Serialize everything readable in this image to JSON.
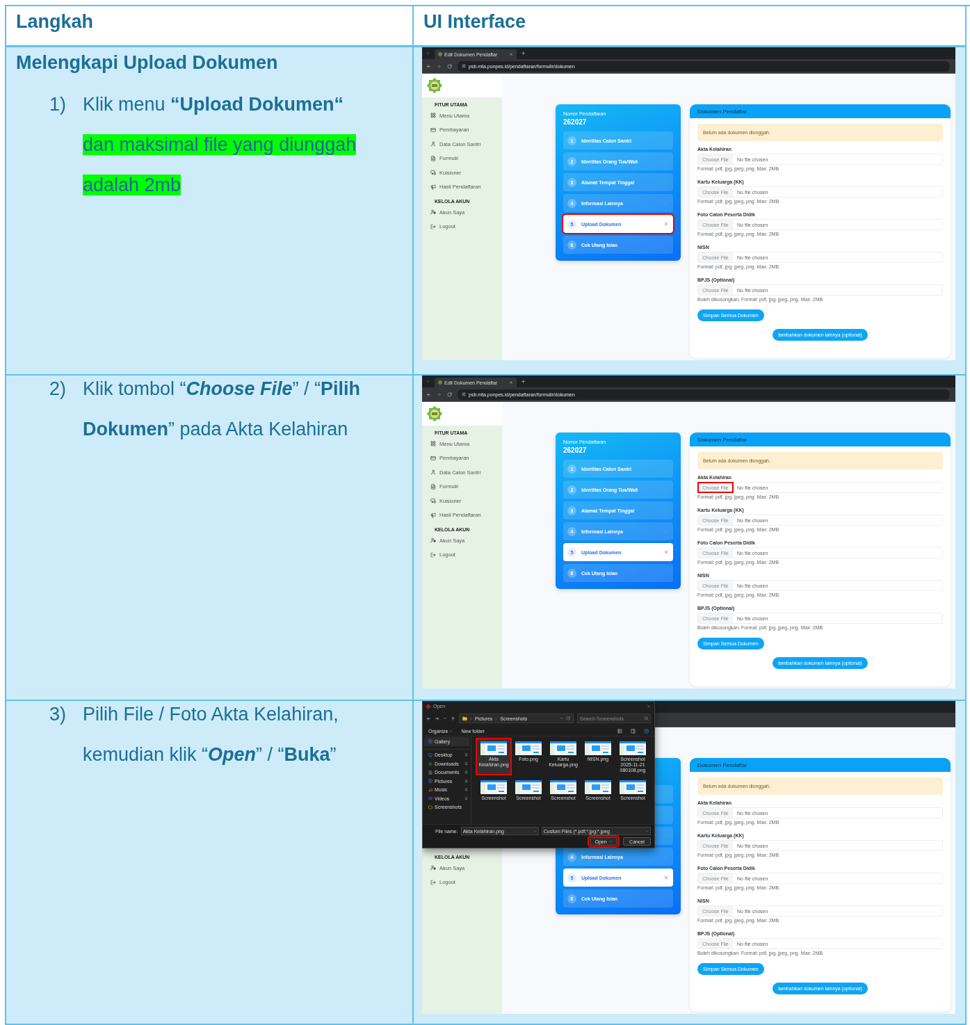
{
  "table": {
    "columns": [
      "Langkah",
      "UI Interface"
    ]
  },
  "rows": [
    {
      "heading": "Melengkapi Upload Dokumen",
      "step": {
        "number": "1)",
        "text": "Klik menu **“Upload Dokumen“**",
        "highlight": "dan maksimal file yang diunggah adalah 2mb"
      },
      "screen": {
        "browser": {
          "tab_title": "Edit Dokumen Pendaftar",
          "url": "psb.mta.ponpes.id/pendaftaran/formulir/dokumen"
        },
        "sidebar": [
          {
            "kind": "heading",
            "label": "FITUR UTAMA"
          },
          {
            "kind": "link",
            "label": "Menu Utama"
          },
          {
            "kind": "link",
            "label": "Pembayaran"
          },
          {
            "kind": "link",
            "label": "Data Calon Santri"
          },
          {
            "kind": "link",
            "label": "Formulir"
          },
          {
            "kind": "link",
            "label": "Kuisioner"
          },
          {
            "kind": "link",
            "label": "Hasil Pendaftaran"
          },
          {
            "kind": "heading",
            "label": "KELOLA AKUN"
          },
          {
            "kind": "link",
            "label": "Akun Saya"
          },
          {
            "kind": "link",
            "label": "Logout"
          }
        ],
        "registration": {
          "label": "Nomor Pendaftaran",
          "number": "262027"
        },
        "steps": [
          {
            "number": "1",
            "label": "Identitas Calon Santri",
            "checked": true,
            "error": false,
            "selected": false,
            "highlighted": false
          },
          {
            "number": "2",
            "label": "Identitas Orang Tua/Wali",
            "checked": true,
            "error": false,
            "selected": false,
            "highlighted": false
          },
          {
            "number": "3",
            "label": "Alamat Tempat Tinggal",
            "checked": true,
            "error": false,
            "selected": false,
            "highlighted": false
          },
          {
            "number": "4",
            "label": "Informasi Lainnya",
            "checked": true,
            "error": false,
            "selected": false,
            "highlighted": false
          },
          {
            "number": "5",
            "label": "Upload Dokumen",
            "checked": false,
            "error": true,
            "selected": true,
            "highlighted": true
          },
          {
            "number": "6",
            "label": "Cek Ulang Isian",
            "checked": false,
            "error": false,
            "selected": false,
            "highlighted": false
          }
        ],
        "documents": {
          "title": "Dokumen Pendaftar",
          "alert": "Belum ada dokumen diunggah.",
          "fields": [
            {
              "label": "Akta Kelahiran",
              "button": "Choose File",
              "value": "No file chosen",
              "hint": "Format: pdf, jpg, jpeg, png. Max: 2MB",
              "highlighted": false
            },
            {
              "label": "Kartu Keluarga (KK)",
              "button": "Choose File",
              "value": "No file chosen",
              "hint": "Format: pdf, jpg, jpeg, png. Max: 2MB",
              "highlighted": false
            },
            {
              "label": "Foto Calon Peserta Didik",
              "button": "Choose File",
              "value": "No file chosen",
              "hint": "Format: pdf, jpg, jpeg, png. Max: 2MB",
              "highlighted": false
            },
            {
              "label": "NISN",
              "button": "Choose File",
              "value": "No file chosen",
              "hint": "Format: pdf, jpg, jpeg, png. Max: 2MB",
              "highlighted": false
            },
            {
              "label": "BPJS (Optional)",
              "button": "Choose File",
              "value": "No file chosen",
              "hint": "Boleh dikosongkan. Format: pdf, jpg, jpeg, png. Max: 2MB",
              "highlighted": false
            }
          ],
          "save": "Simpan Semua Dokumen",
          "add": "tambahkan dokumen lainnya (optional)"
        }
      }
    },
    {
      "step": {
        "number": "2)",
        "text": "Klik tombol “*Choose File*” / “**Pilih Dokumen**” pada Akta Kelahiran"
      },
      "screen": {
        "browser": {
          "tab_title": "Edit Dokumen Pendaftar",
          "url": "psb.mta.ponpes.id/pendaftaran/formulir/dokumen"
        },
        "sidebar": [
          {
            "kind": "heading",
            "label": "FITUR UTAMA"
          },
          {
            "kind": "link",
            "label": "Menu Utama"
          },
          {
            "kind": "link",
            "label": "Pembayaran"
          },
          {
            "kind": "link",
            "label": "Data Calon Santri"
          },
          {
            "kind": "link",
            "label": "Formulir"
          },
          {
            "kind": "link",
            "label": "Kuisioner"
          },
          {
            "kind": "link",
            "label": "Hasil Pendaftaran"
          },
          {
            "kind": "heading",
            "label": "KELOLA AKUN"
          },
          {
            "kind": "link",
            "label": "Akun Saya"
          },
          {
            "kind": "link",
            "label": "Logout"
          }
        ],
        "registration": {
          "label": "Nomor Pendaftaran",
          "number": "262027"
        },
        "steps": [
          {
            "number": "1",
            "label": "Identitas Calon Santri",
            "checked": true,
            "error": false,
            "selected": false,
            "highlighted": false
          },
          {
            "number": "2",
            "label": "Identitas Orang Tua/Wali",
            "checked": true,
            "error": false,
            "selected": false,
            "highlighted": false
          },
          {
            "number": "3",
            "label": "Alamat Tempat Tinggal",
            "checked": true,
            "error": false,
            "selected": false,
            "highlighted": false
          },
          {
            "number": "4",
            "label": "Informasi Lainnya",
            "checked": true,
            "error": false,
            "selected": false,
            "highlighted": false
          },
          {
            "number": "5",
            "label": "Upload Dokumen",
            "checked": false,
            "error": true,
            "selected": true,
            "highlighted": false
          },
          {
            "number": "6",
            "label": "Cek Ulang Isian",
            "checked": false,
            "error": false,
            "selected": false,
            "highlighted": false
          }
        ],
        "documents": {
          "title": "Dokumen Pendaftar",
          "alert": "Belum ada dokumen diunggah.",
          "fields": [
            {
              "label": "Akta Kelahiran",
              "button": "Choose File",
              "value": "No file chosen",
              "hint": "Format: pdf, jpg, jpeg, png. Max: 2MB",
              "highlighted": true
            },
            {
              "label": "Kartu Keluarga (KK)",
              "button": "Choose File",
              "value": "No file chosen",
              "hint": "Format: pdf, jpg, jpeg, png. Max: 2MB",
              "highlighted": false
            },
            {
              "label": "Foto Calon Peserta Didik",
              "button": "Choose File",
              "value": "No file chosen",
              "hint": "Format: pdf, jpg, jpeg, png. Max: 2MB",
              "highlighted": false
            },
            {
              "label": "NISN",
              "button": "Choose File",
              "value": "No file chosen",
              "hint": "Format: pdf, jpg, jpeg, png. Max: 2MB",
              "highlighted": false
            },
            {
              "label": "BPJS (Optional)",
              "button": "Choose File",
              "value": "No file chosen",
              "hint": "Boleh dikosongkan. Format: pdf, jpg, jpeg, png. Max: 2MB",
              "highlighted": false
            }
          ],
          "save": "Simpan Semua Dokumen",
          "add": "tambahkan dokumen lainnya (optional)"
        }
      }
    },
    {
      "step": {
        "number": "3)",
        "text": "Pilih File / Foto Akta Kelahiran, kemudian klik “*Open*” / “**Buka**”"
      },
      "screen": {
        "sidebar": [
          {
            "kind": "heading",
            "label": "KELOLA AKUN"
          },
          {
            "kind": "link",
            "label": "Akun Saya"
          },
          {
            "kind": "link",
            "label": "Logout"
          }
        ],
        "steps": [
          {
            "checked": true,
            "error": false,
            "selected": false,
            "highlighted": false
          },
          {
            "checked": true,
            "error": false,
            "selected": false,
            "highlighted": false
          },
          {
            "checked": true,
            "error": false,
            "selected": false,
            "highlighted": false
          },
          {
            "number": "4",
            "label": "Informasi Lainnya",
            "checked": true,
            "error": false,
            "selected": false,
            "highlighted": false
          },
          {
            "number": "5",
            "label": "Upload Dokumen",
            "checked": false,
            "error": true,
            "selected": true,
            "highlighted": false
          },
          {
            "number": "6",
            "label": "Cek Ulang Isian",
            "checked": false,
            "error": false,
            "selected": false,
            "highlighted": false
          }
        ],
        "documents": {
          "title": "Dokumen Pendaftar",
          "alert": "Belum ada dokumen diunggah.",
          "fields": [
            {
              "label": "Akta Kelahiran",
              "button": "Choose File",
              "value": "No file chosen",
              "hint": "Format: pdf, jpg, jpeg, png. Max: 2MB",
              "highlighted": false
            },
            {
              "label": "Kartu Keluarga (KK)",
              "button": "Choose File",
              "value": "No file chosen",
              "hint": "Format: pdf, jpg, jpeg, png. Max: 2MB",
              "highlighted": false
            },
            {
              "label": "Foto Calon Peserta Didik",
              "button": "Choose File",
              "value": "No file chosen",
              "hint": "Format: pdf, jpg, jpeg, png. Max: 2MB",
              "highlighted": false
            },
            {
              "label": "NISN",
              "button": "Choose File",
              "value": "No file chosen",
              "hint": "Format: pdf, jpg, jpeg, png. Max: 2MB",
              "highlighted": false
            },
            {
              "label": "BPJS (Optional)",
              "button": "Choose File",
              "value": "No file chosen",
              "hint": "Boleh dikosongkan. Format: pdf, jpg, jpeg, png. Max: 2MB",
              "highlighted": false
            }
          ],
          "save": "Simpan Semua Dokumen",
          "add": "tambahkan dokumen lainnya (optional)"
        },
        "dialog": {
          "title": "Open",
          "path": [
            "Pictures",
            "Screenshots"
          ],
          "search_placeholder": "Search Screenshots",
          "toolbar": [
            "Organize",
            "New folder"
          ],
          "places": [
            {
              "label": "Gallery",
              "selected": true,
              "pinned": false
            },
            {
              "label": "Desktop",
              "selected": false,
              "pinned": true
            },
            {
              "label": "Downloads",
              "selected": false,
              "pinned": true
            },
            {
              "label": "Documents",
              "selected": false,
              "pinned": true
            },
            {
              "label": "Pictures",
              "selected": false,
              "pinned": true
            },
            {
              "label": "Music",
              "selected": false,
              "pinned": true
            },
            {
              "label": "Videos",
              "selected": false,
              "pinned": true
            },
            {
              "label": "Screenshots",
              "selected": false,
              "pinned": false
            }
          ],
          "files": [
            {
              "name": "Akta Kelahiran.png",
              "selected": true,
              "highlighted": true
            },
            {
              "name": "Foto.png",
              "selected": false,
              "highlighted": false
            },
            {
              "name": "Kartu Keluarga.png",
              "selected": false,
              "highlighted": false
            },
            {
              "name": "NISN.png",
              "selected": false,
              "highlighted": false
            },
            {
              "name": "Screenshot 2025-11-21 080108.png",
              "selected": false,
              "highlighted": false
            },
            {
              "name": "Screenshot",
              "selected": false,
              "highlighted": false
            },
            {
              "name": "Screenshot",
              "selected": false,
              "highlighted": false
            },
            {
              "name": "Screenshot",
              "selected": false,
              "highlighted": false
            },
            {
              "name": "Screenshot",
              "selected": false,
              "highlighted": false
            },
            {
              "name": "Screenshot",
              "selected": false,
              "highlighted": false
            }
          ],
          "file_name_label": "File name:",
          "file_name": "Akta Kelahiran.png",
          "filter": "Custom Files (*.pdf;*.jpg;*.jpeg",
          "buttons": [
            {
              "label": "Open",
              "kind": "primary",
              "highlighted": true
            },
            {
              "label": "Cancel",
              "kind": "secondary",
              "highlighted": false
            }
          ]
        }
      }
    }
  ]
}
